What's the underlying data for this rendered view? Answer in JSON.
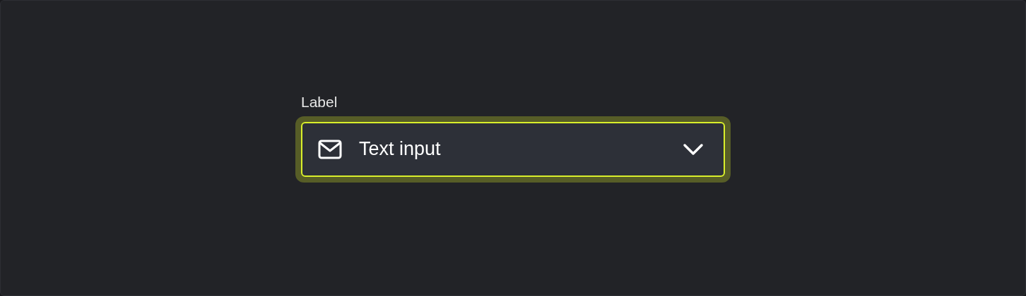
{
  "field": {
    "label": "Label",
    "value": "Text input",
    "focused": true
  }
}
